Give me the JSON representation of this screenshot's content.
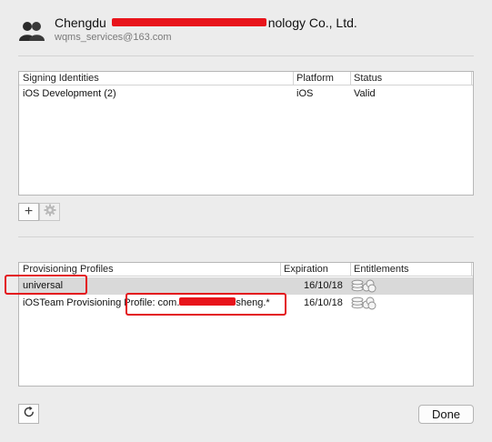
{
  "header": {
    "team_name": "Chengdu Y          Technology Co., Ltd.",
    "team_name_start": "Chengdu",
    "team_name_end": "nology Co., Ltd.",
    "email": "wqms_services@163.com",
    "icon": "people-icon"
  },
  "signing": {
    "columns": [
      "Signing Identities",
      "Platform",
      "Status"
    ],
    "rows": [
      {
        "identity": "iOS Development (2)",
        "platform": "iOS",
        "status": "Valid"
      }
    ],
    "add_label": "+",
    "gear_icon": "gear-icon"
  },
  "profiles": {
    "columns": [
      "Provisioning Profiles",
      "Expiration",
      "Entitlements"
    ],
    "rows": [
      {
        "name": "universal",
        "expiration": "16/10/18",
        "entitlements_icon": "entitlements-icon"
      },
      {
        "name_start": "iOSTeam Provisioning Profile: com.",
        "name_end": "sheng.*",
        "expiration": "16/10/18",
        "entitlements_icon": "entitlements-icon"
      }
    ]
  },
  "footer": {
    "refresh_icon": "refresh-icon",
    "done_label": "Done"
  },
  "colors": {
    "annotation": "#e3141b",
    "selected_row": "#d9d9d9"
  }
}
